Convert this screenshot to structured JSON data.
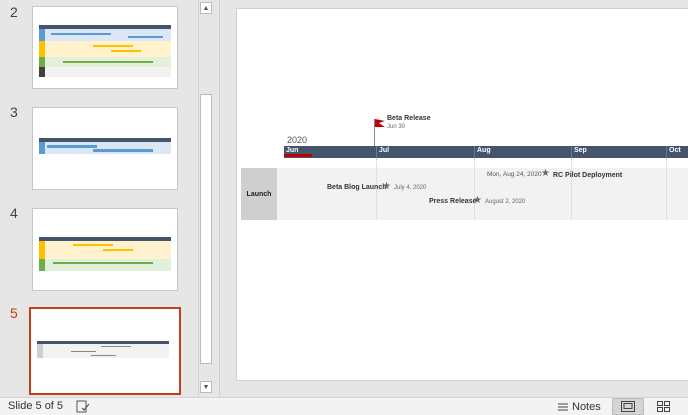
{
  "thumbnails": [
    {
      "number": "2",
      "active": false
    },
    {
      "number": "3",
      "active": false
    },
    {
      "number": "4",
      "active": false
    },
    {
      "number": "5",
      "active": true
    }
  ],
  "slide": {
    "year": "2020",
    "months": [
      "Jun",
      "Jul",
      "Aug",
      "Sep",
      "Oct"
    ],
    "swimlane": "Launch",
    "flag_milestone": {
      "title": "Beta Release",
      "date": "Jun 30"
    },
    "milestones": [
      {
        "label": "Beta Blog Launch",
        "date": "July 4, 2020"
      },
      {
        "label": "Press Release",
        "date": "August 2, 2020"
      },
      {
        "label": "RC Pilot Deployment",
        "date": "Mon, Aug 24, 2020"
      }
    ]
  },
  "status": {
    "slide_count": "Slide 5 of 5",
    "notes_label": "Notes"
  },
  "colors": {
    "accent": "#c43e1c",
    "timeline_bar": "#44546a",
    "swimlane_box": "#cfcfcf",
    "swimlane_band": "#f2f2f2"
  }
}
